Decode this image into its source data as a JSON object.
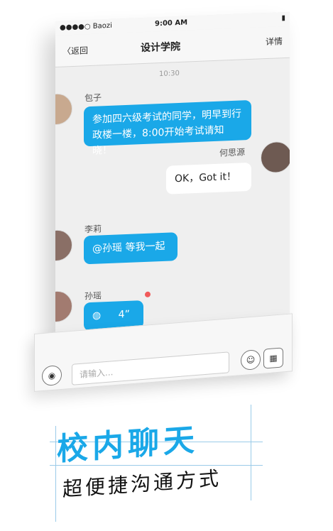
{
  "status_bar": {
    "carrier": "●●●●○ Baozi",
    "time": "9:00 AM"
  },
  "navbar": {
    "back_label": "〈返回",
    "title": "设计学院",
    "detail_label": "详情"
  },
  "chat": {
    "timestamp": "10:30",
    "messages": [
      {
        "sender": "包子",
        "text": "参加四六级考试的同学，明早到行政楼一楼，8:00开始考试请知晓！",
        "side": "left"
      },
      {
        "sender": "何思源",
        "text": "OK，Got it！",
        "side": "right"
      },
      {
        "sender": "李莉",
        "text": "@孙瑶  等我一起",
        "side": "left"
      },
      {
        "sender": "孙瑶",
        "text": "4”",
        "side": "left",
        "type": "voice"
      }
    ]
  },
  "composer": {
    "placeholder": "请输入..."
  },
  "headline": {
    "title": "校内聊天",
    "subtitle": "超便捷沟通方式"
  },
  "colors": {
    "accent": "#1aa8e8",
    "unread_dot": "#f15a5a"
  }
}
